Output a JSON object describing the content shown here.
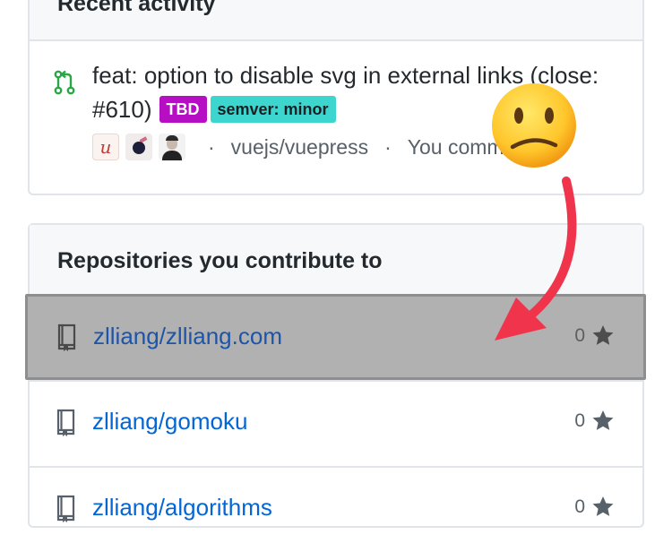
{
  "recent_activity": {
    "title": "Recent activity",
    "item": {
      "icon": "git-pull-request-icon",
      "title": "feat: option to disable svg in external links (close: #610)",
      "labels": [
        {
          "text": "TBD",
          "color": "#b60fc3"
        },
        {
          "text": "semver: minor",
          "color": "#3dd6cf"
        }
      ],
      "avatar_letter": "u",
      "repo": "vuejs/vuepress",
      "status": "You commented"
    }
  },
  "repositories": {
    "title": "Repositories you contribute to",
    "items": [
      {
        "name": "zlliang/zlliang.com",
        "stars": "0",
        "icon": "repo-icon"
      },
      {
        "name": "zlliang/gomoku",
        "stars": "0",
        "icon": "repo-icon"
      },
      {
        "name": "zlliang/algorithms",
        "stars": "0",
        "icon": "repo-icon"
      }
    ]
  },
  "annotation": {
    "emoji": "slightly-frowning-face",
    "arrow_color": "#f0344c"
  }
}
